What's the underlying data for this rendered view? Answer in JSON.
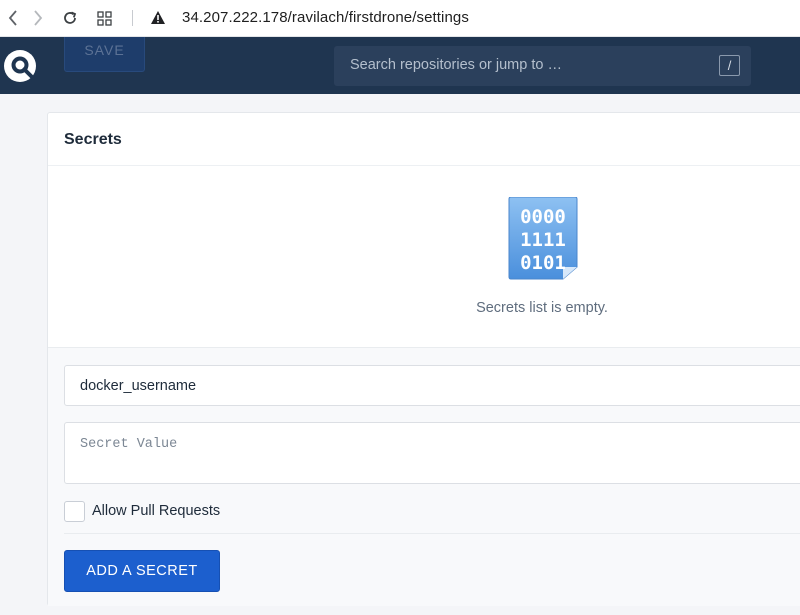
{
  "browser": {
    "url": "34.207.222.178/ravilach/firstdrone/settings",
    "icons": [
      "back-icon",
      "forward-icon",
      "reload-icon",
      "tabs-grid-icon",
      "warning-icon"
    ]
  },
  "header": {
    "save_label": "SAVE",
    "search": {
      "placeholder": "Search repositories or jump to …",
      "shortcut": "/"
    },
    "colors": {
      "background": "#1f3550",
      "search_bg": "#2b405c"
    }
  },
  "secrets": {
    "title": "Secrets",
    "empty_icon": "binary-file-icon",
    "empty_icon_digits": [
      "0000",
      "1111",
      "0101"
    ],
    "empty_message": "Secrets list is empty.",
    "form": {
      "name_value": "docker_username",
      "value_placeholder": "Secret Value",
      "allow_pull_requests_label": "Allow Pull Requests",
      "allow_pull_requests_checked": false,
      "add_button_label": "ADD A SECRET"
    },
    "colors": {
      "primary_button": "#1c5fce"
    }
  }
}
